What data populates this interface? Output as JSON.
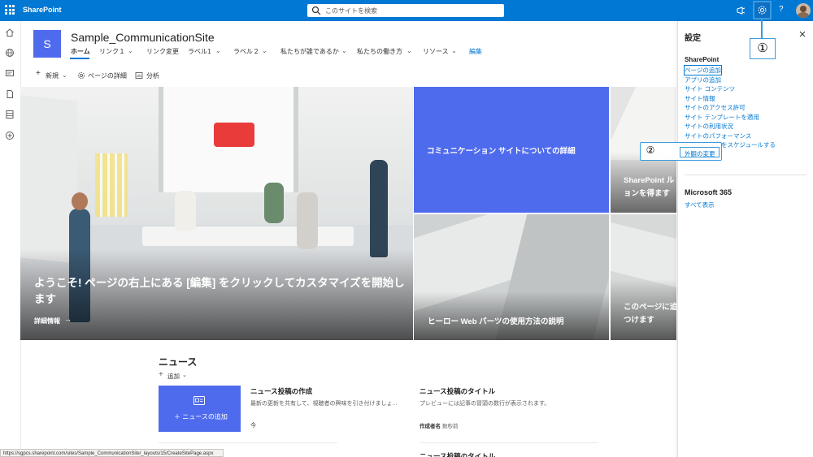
{
  "topbar": {
    "app_name": "SharePoint",
    "search_placeholder": "このサイトを検索",
    "help_label": "?"
  },
  "site": {
    "logo_letter": "S",
    "title": "Sample_CommunicationSite",
    "nav": [
      {
        "label": "ホーム"
      },
      {
        "label": "リンク１"
      },
      {
        "label": "リンク変更"
      },
      {
        "label": "ラベル1"
      },
      {
        "label": "ラベル２"
      },
      {
        "label": "私たちが誰であるか"
      },
      {
        "label": "私たちの働き方"
      },
      {
        "label": "リソース"
      },
      {
        "label": "編集"
      }
    ]
  },
  "commandbar": {
    "new_label": "新規",
    "page_details_label": "ページの詳細",
    "analytics_label": "分析"
  },
  "hero": {
    "main_title": "ようこそ! ページの右上にある [編集] をクリックしてカスタマイズを開始します",
    "main_link": "詳細情報",
    "blue_tile_title": "コミュニケーション サイトについての詳細",
    "bottom_tile_title": "ヒーロー Web パーツの使用方法の説明",
    "right_top_title": "SharePoint ル ョンを得ます",
    "right_bottom_title": "このページに追 つけます"
  },
  "news": {
    "heading": "ニュース",
    "add_label": "追加",
    "card_add_label": "ニュースの追加",
    "item1_title": "ニュース投稿の作成",
    "item1_desc": "最新の更新を共有して、視聴者の興味を引き付けましょ...",
    "item1_meta": "今",
    "item2_title": "ニュース投稿のタイトル",
    "item2_desc": "プレビューには記事の冒頭の数行が表示されます。",
    "item2_author_label": "作成者名",
    "item2_time": "数秒前",
    "item3_title": "ニュース投稿のタイトル"
  },
  "settings_panel": {
    "title": "設定",
    "sharepoint_heading": "SharePoint",
    "links": [
      "ページの追加",
      "アプリの追加",
      "サイト コンテンツ",
      "サイト情報",
      "サイトのアクセス許可",
      "サイト テンプレートを適用",
      "サイトの利用状況",
      "サイトのパフォーマンス",
      "サイトの起動をスケジュールする",
      "外観の変更"
    ],
    "m365_heading": "Microsoft 365",
    "see_all": "すべて表示"
  },
  "annotations": {
    "callout1": "①",
    "callout2": "②"
  },
  "statusbar": {
    "url": "https://sgpcs.sharepoint.com/sites/Sample_CommunicationSite/_layouts/15/CreateSitePage.aspx"
  },
  "colors": {
    "suite_bar": "#0078d4",
    "site_accent": "#4f6bed",
    "link": "#0078d4",
    "callout_border": "#3a9bdc"
  },
  "icons": [
    "waffle-icon",
    "search-icon",
    "megaphone-icon",
    "gear-icon",
    "help-icon",
    "avatar",
    "home-icon",
    "globe-icon",
    "news-icon",
    "document-icon",
    "list-icon",
    "add-circle-icon",
    "close-icon",
    "arrow-right-icon",
    "chevron-down-icon"
  ]
}
